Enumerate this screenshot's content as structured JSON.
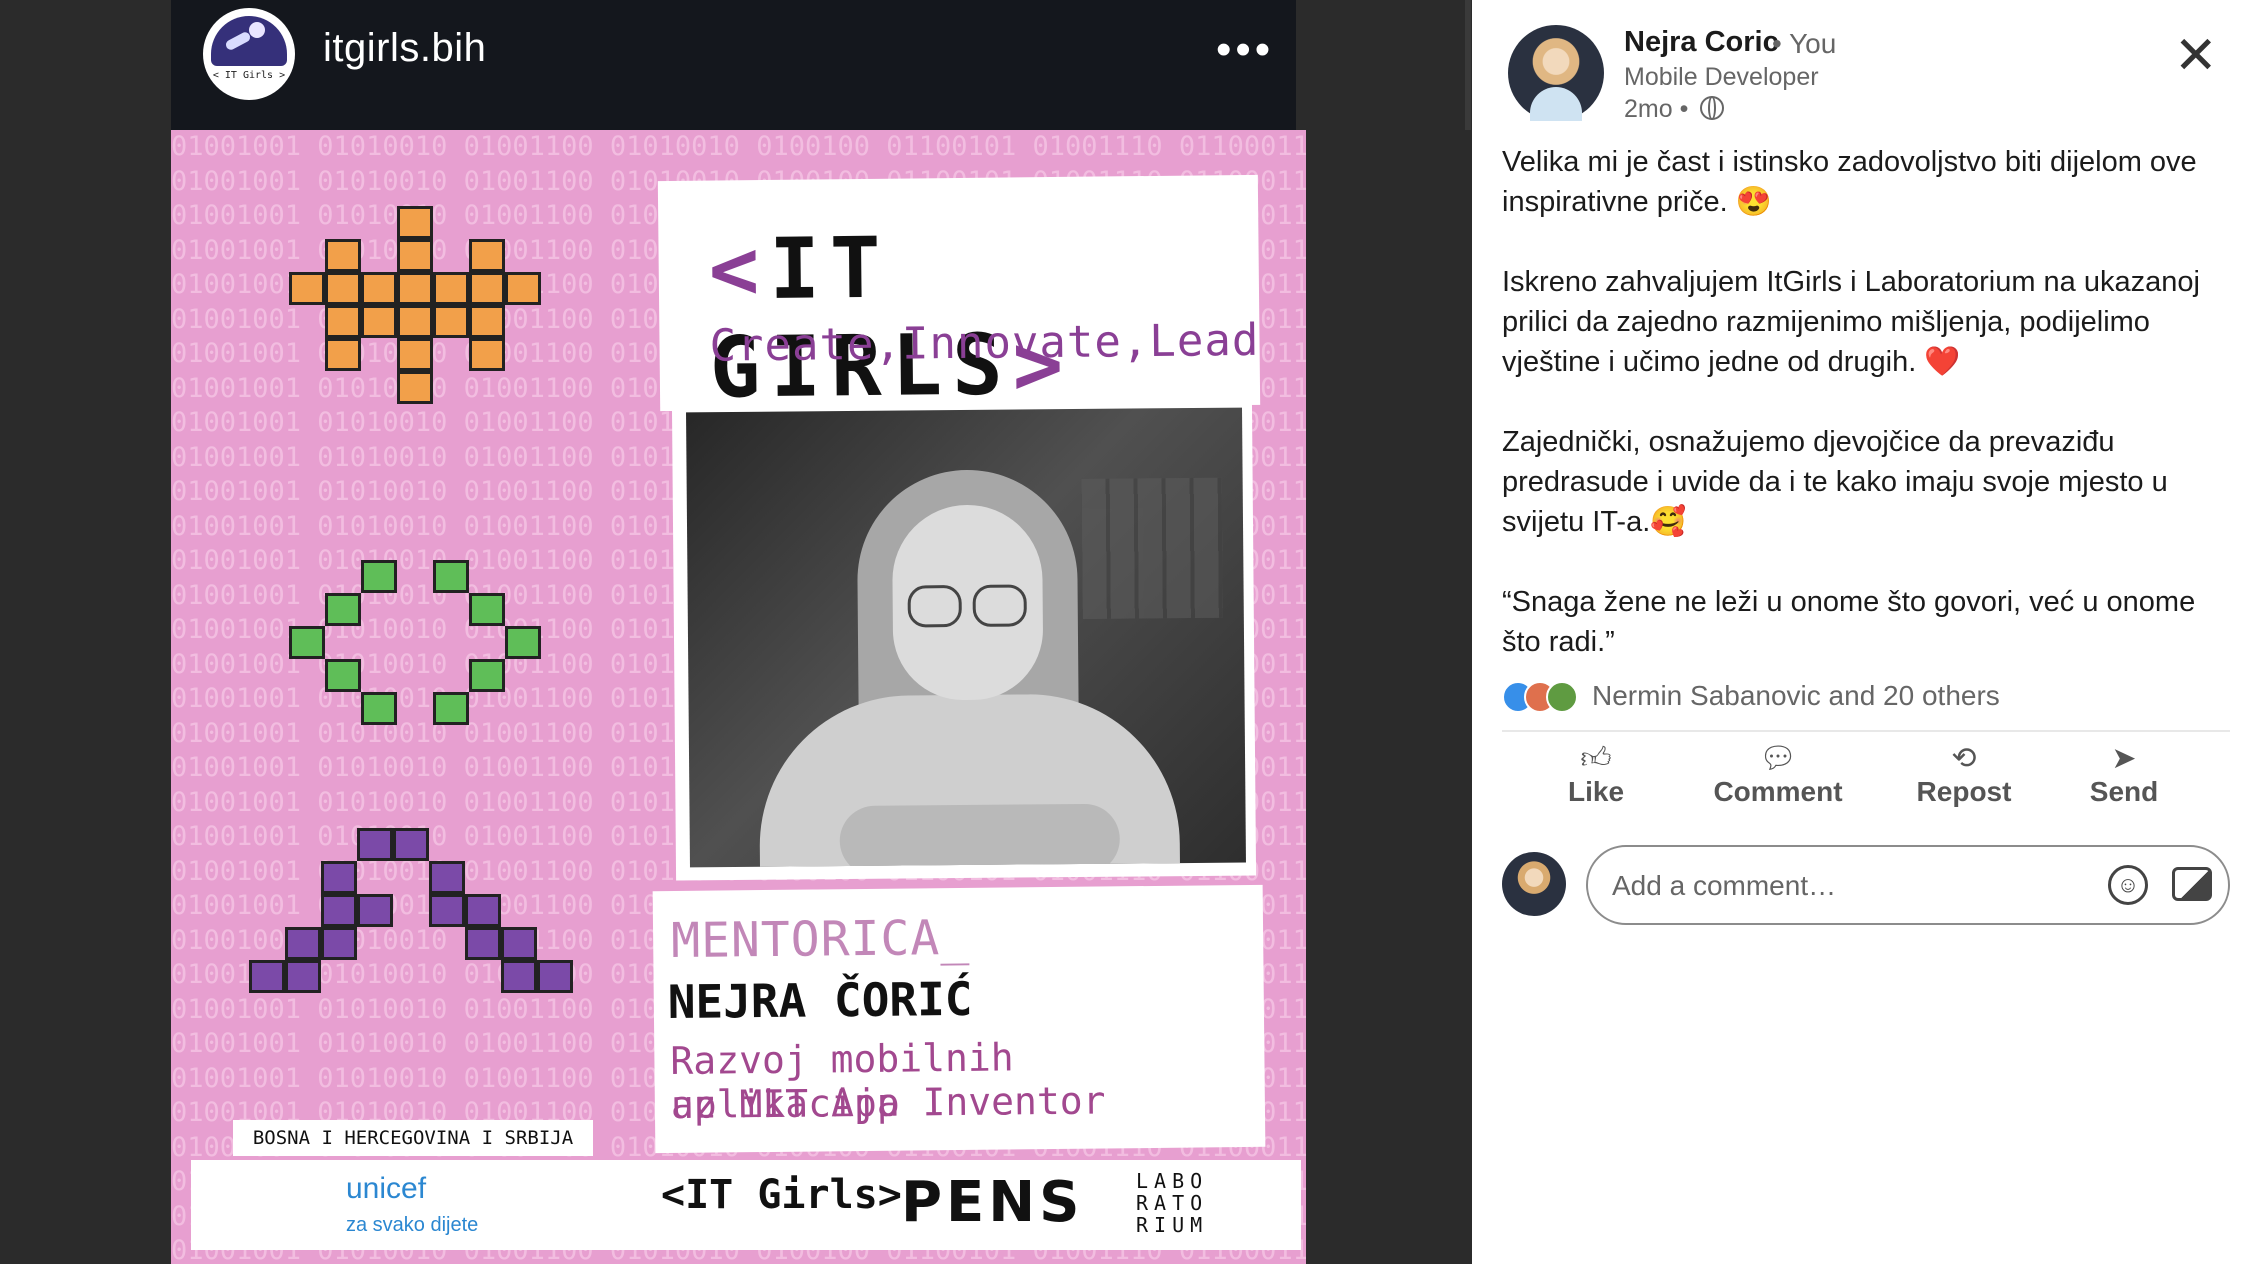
{
  "post": {
    "account_name": "itgirls.bih",
    "avatar_text": "< IT Girls >",
    "more_icon": "ellipsis-icon"
  },
  "poster": {
    "binary_line": "01001001 01010010 01001100 01010010 0100100 01100101 01001110 01100011 00111 01001001 01010010 01001100 01010010 0100100 01100101 01001110 01100011",
    "title_open": "<",
    "title_text": "IT GIRLS",
    "title_close": ">",
    "tagline": "Create,Innovate,Lead",
    "role": "MENTORICA_",
    "name": "NEJRA ČORIĆ",
    "course_line1": "Razvoj mobilnih aplikacija",
    "course_line2": "uz MIT App Inventor",
    "region": "BOSNA I HERCEGOVINA I SRBIJA",
    "unicef": "unicef",
    "unicef_sub": "za svako dijete",
    "itgirls_logo": "<IT Girls>",
    "pens_logo": "PENS",
    "labo_logo": "LABO RATO RIUM"
  },
  "panel": {
    "author": "Nejra Coric",
    "you_label": "• You",
    "headline": "Mobile Developer",
    "time": "2mo •",
    "visibility_icon": "globe-icon",
    "paragraphs": [
      "Velika mi je čast i istinsko zadovoljstvo biti dijelom ove inspirativne priče. 😍",
      "Iskreno zahvaljujem ItGirls i Laboratorium na ukazanoj prilici da zajedno razmijenimo mišljenja, podijelimo vještine i učimo jedne od drugih. ❤️",
      "Zajednički, osnažujemo djevojčice da prevaziđu predrasude i uvide da i te kako imaju svoje mjesto u svijetu IT-a.🥰",
      "“Snaga žene ne leži u onome što govori, već u onome što radi.”"
    ],
    "reactions_text": "Nermin Sabanovic and 20 others",
    "actions": {
      "like": "Like",
      "comment": "Comment",
      "repost": "Repost",
      "send": "Send"
    },
    "comment_placeholder": "Add a comment…"
  }
}
